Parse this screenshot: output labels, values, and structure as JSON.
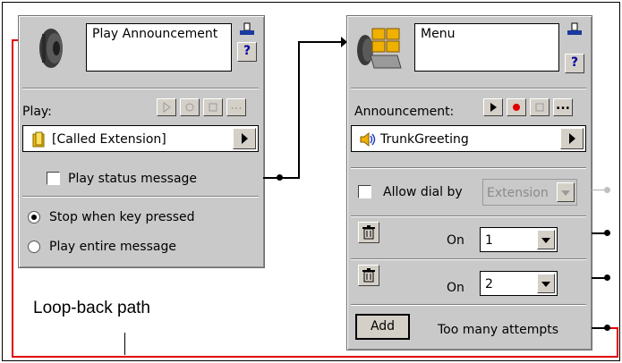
{
  "block_play": {
    "title": "Play Announcement",
    "play_label": "Play:",
    "extension_value": "[Called Extension]",
    "status_checkbox_label": "Play status message",
    "radio_stop": "Stop when key pressed",
    "radio_entire": "Play entire message",
    "more_button": "..."
  },
  "block_menu": {
    "title": "Menu",
    "announcement_label": "Announcement:",
    "announcement_value": "TrunkGreeting",
    "allow_dial_label": "Allow dial by",
    "allow_dial_value": "Extension",
    "on_label": "On",
    "key_options": [
      {
        "on_label": "On",
        "value": "1"
      },
      {
        "on_label": "On",
        "value": "2"
      }
    ],
    "add_button": "Add",
    "too_many_label": "Too many attempts",
    "more_button": "..."
  },
  "annotation": {
    "loopback_label": "Loop-back path"
  },
  "colors": {
    "block_bg": "#c9c9c9",
    "loop_line": "#e00000",
    "record_red": "#e00000",
    "help_blue": "#0000a0"
  }
}
